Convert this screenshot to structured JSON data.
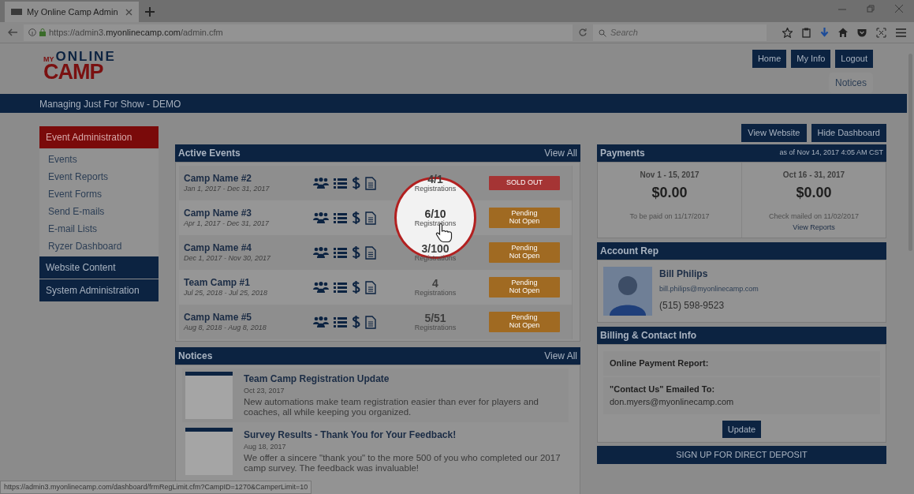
{
  "browser": {
    "tab_title": "My Online Camp Admin",
    "url_prefix": "https://admin3.",
    "url_domain": "myonlinecamp.com",
    "url_path": "/admin.cfm",
    "search_placeholder": "Search"
  },
  "logo": {
    "small": "MY",
    "top": "ONLINE",
    "big": "CAMP"
  },
  "header": {
    "buttons": [
      "Home",
      "My Info",
      "Logout"
    ],
    "notices_button": "Notices"
  },
  "banner": "Managing Just For Show - DEMO",
  "sidebar": [
    {
      "label": "Event Administration",
      "selected": true,
      "children": [
        {
          "label": "Events"
        },
        {
          "label": "Event Reports"
        },
        {
          "label": "Event Forms"
        },
        {
          "label": "Send E-mails"
        },
        {
          "label": "E-mail Lists"
        },
        {
          "label": "Ryzer Dashboard"
        }
      ]
    },
    {
      "label": "Website Content",
      "selected": false
    },
    {
      "label": "System Administration",
      "selected": false
    }
  ],
  "top_buttons": [
    "View Website",
    "Hide Dashboard"
  ],
  "active_events": {
    "title": "Active Events",
    "view_all": "View All",
    "rows": [
      {
        "name": "Camp Name #2",
        "dates": "Jan 1, 2017 - Dec 31, 2017",
        "count": "4/1",
        "count_label": "Registrations",
        "status": {
          "kind": "sold_out",
          "lines": [
            "SOLD OUT"
          ]
        },
        "magnified": false
      },
      {
        "name": "Camp Name #3",
        "dates": "Apr 1, 2017 - Dec 31, 2017",
        "count": "6/10",
        "count_label": "Registrations",
        "status": {
          "kind": "pending",
          "lines": [
            "Pending",
            "Not Open"
          ]
        },
        "magnified": true
      },
      {
        "name": "Camp Name #4",
        "dates": "Dec 1, 2017 - Nov 30, 2017",
        "count": "3/100",
        "count_label": "Registrations",
        "status": {
          "kind": "pending",
          "lines": [
            "Pending",
            "Not Open"
          ]
        },
        "magnified": false
      },
      {
        "name": "Team Camp #1",
        "dates": "Jul 25, 2018 - Jul 25, 2018",
        "count": "4",
        "count_label": "Registrations",
        "status": {
          "kind": "pending",
          "lines": [
            "Pending",
            "Not Open"
          ]
        },
        "magnified": false
      },
      {
        "name": "Camp Name #5",
        "dates": "Aug 8, 2018 - Aug 8, 2018",
        "count": "5/51",
        "count_label": "Registrations",
        "status": {
          "kind": "pending",
          "lines": [
            "Pending",
            "Not Open"
          ]
        },
        "magnified": false
      }
    ]
  },
  "notices": {
    "title": "Notices",
    "view_all": "View All",
    "items": [
      {
        "title": "Team Camp Registration Update",
        "date": "Oct 23, 2017",
        "body": "New automations make team registration easier than ever for players and coaches, all while keeping you organized."
      },
      {
        "title": "Survey Results - Thank You for Your Feedback!",
        "date": "Aug 18, 2017",
        "body": "We offer a sincere \"thank you\" to the more 500 of you who completed our 2017 camp survey. The feedback was invaluable!"
      }
    ]
  },
  "payments": {
    "title": "Payments",
    "as_of": "as of Nov 14, 2017 4:05 AM CST",
    "periods": [
      {
        "dates": "Nov 1 - 15, 2017",
        "amount": "$0.00",
        "note": "To be paid on 11/17/2017"
      },
      {
        "dates": "Oct 16 - 31, 2017",
        "amount": "$0.00",
        "note": "Check mailed on 11/02/2017",
        "link": "View Reports"
      }
    ]
  },
  "account_rep": {
    "title": "Account Rep",
    "name": "Bill Philips",
    "email": "bill.philips@myonlinecamp.com",
    "phone": "(515) 598-9523"
  },
  "billing": {
    "title": "Billing & Contact Info",
    "items": [
      {
        "label": "Online Payment Report:"
      },
      {
        "label": "\"Contact Us\" Emailed To:",
        "value": "don.myers@myonlinecamp.com"
      }
    ],
    "button": "Update"
  },
  "deposit_button": "SIGN UP FOR DIRECT DEPOSIT",
  "status_url": "https://admin3.myonlinecamp.com/dashboard/frmRegLimit.cfm?CampID=1270&CamperLimit=10"
}
